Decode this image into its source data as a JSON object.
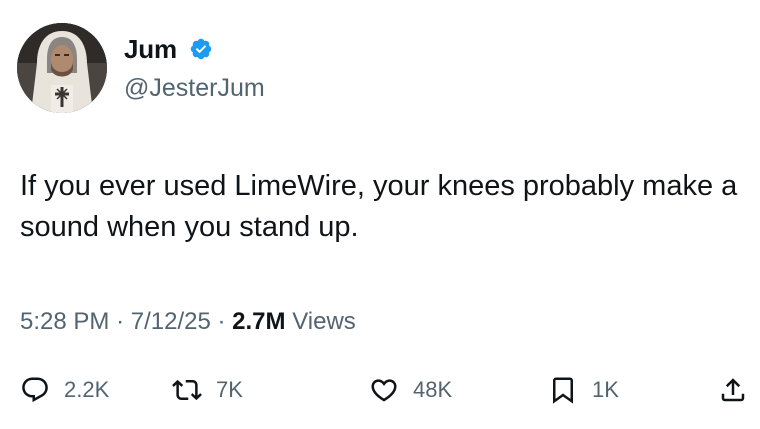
{
  "author": {
    "display_name": "Jum",
    "handle": "@JesterJum",
    "verified": true,
    "avatar_icon": "avatar-hooded-knight"
  },
  "tweet": {
    "text": "If you ever used LimeWire, your knees probably make a sound when you stand up."
  },
  "meta": {
    "time": "5:28 PM",
    "sep1": "·",
    "date": "7/12/25",
    "sep2": "·",
    "views_count": "2.7M",
    "views_label": "Views"
  },
  "actions": {
    "reply": {
      "icon": "reply-icon",
      "count": "2.2K"
    },
    "repost": {
      "icon": "repost-icon",
      "count": "7K"
    },
    "like": {
      "icon": "heart-icon",
      "count": "48K"
    },
    "bookmark": {
      "icon": "bookmark-icon",
      "count": "1K"
    },
    "share": {
      "icon": "share-icon"
    }
  },
  "colors": {
    "text_primary": "#0f1419",
    "text_secondary": "#536471",
    "verified_blue": "#1d9bf0",
    "background": "#ffffff"
  }
}
